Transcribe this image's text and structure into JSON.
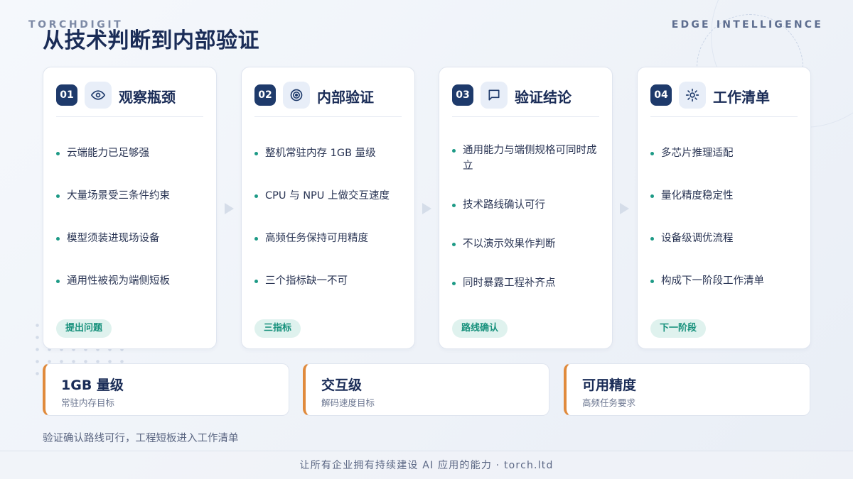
{
  "header": {
    "brand": "TORCHDIGIT",
    "tagline": "EDGE INTELLIGENCE",
    "title": "从技术判断到内部验证"
  },
  "cards": [
    {
      "num": "01",
      "icon": "eye-icon",
      "title": "观察瓶颈",
      "items": [
        "云端能力已足够强",
        "大量场景受三条件约束",
        "模型须装进现场设备",
        "通用性被视为端侧短板"
      ],
      "tag": "提出问题"
    },
    {
      "num": "02",
      "icon": "target-icon",
      "title": "内部验证",
      "items": [
        "整机常驻内存 1GB 量级",
        "CPU 与 NPU 上做交互速度",
        "高频任务保持可用精度",
        "三个指标缺一不可"
      ],
      "tag": "三指标"
    },
    {
      "num": "03",
      "icon": "comment-icon",
      "title": "验证结论",
      "items": [
        "通用能力与端侧规格可同时成立",
        "技术路线确认可行",
        "不以演示效果作判断",
        "同时暴露工程补齐点"
      ],
      "tag": "路线确认"
    },
    {
      "num": "04",
      "icon": "gear-icon",
      "title": "工作清单",
      "items": [
        "多芯片推理适配",
        "量化精度稳定性",
        "设备级调优流程",
        "构成下一阶段工作清单"
      ],
      "tag": "下一阶段"
    }
  ],
  "metrics": [
    {
      "value": "1GB 量级",
      "label": "常驻内存目标"
    },
    {
      "value": "交互级",
      "label": "解码速度目标"
    },
    {
      "value": "可用精度",
      "label": "高频任务要求"
    }
  ],
  "summary": "验证确认路线可行，工程短板进入工作清单",
  "footer": "让所有企业拥有持续建设 AI 应用的能力 · torch.ltd",
  "colors": {
    "navy": "#1e3a6b",
    "teal": "#1d9a86",
    "orange": "#e08a3c"
  }
}
